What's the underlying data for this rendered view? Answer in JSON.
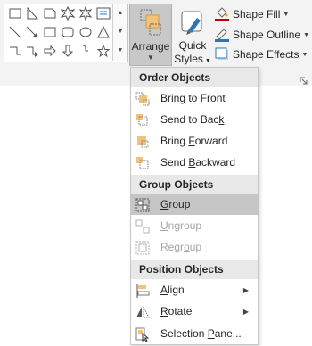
{
  "ribbon": {
    "arrange_label": "Arrange",
    "quick_styles_line1": "Quick",
    "quick_styles_line2": "Styles",
    "shape_fill": "Shape Fill",
    "shape_outline": "Shape Outline",
    "shape_effects": "Shape Effects",
    "colors": {
      "fill_bucket": "#e8a33b",
      "outline_bar": "#2e75b6",
      "fill_bar": "#c00000",
      "arrange_squares": "#f0c27b"
    }
  },
  "menu": {
    "headers": {
      "order": "Order Objects",
      "group": "Group Objects",
      "position": "Position Objects"
    },
    "items": {
      "bring_to_front": {
        "pre": "Bring to ",
        "key": "F",
        "post": "ront"
      },
      "send_to_back": {
        "pre": "Send to Bac",
        "key": "k",
        "post": ""
      },
      "bring_forward": {
        "pre": "Bring ",
        "key": "F",
        "post": "orward"
      },
      "send_backward": {
        "pre": "Send ",
        "key": "B",
        "post": "ackward"
      },
      "group": {
        "pre": "",
        "key": "G",
        "post": "roup"
      },
      "ungroup": {
        "pre": "",
        "key": "U",
        "post": "ngroup"
      },
      "regroup": {
        "pre": "Regr",
        "key": "o",
        "post": "up"
      },
      "align": {
        "pre": "",
        "key": "A",
        "post": "lign"
      },
      "rotate": {
        "pre": "",
        "key": "R",
        "post": "otate"
      },
      "selection_pane": {
        "pre": "Selection ",
        "key": "P",
        "post": "ane..."
      }
    }
  }
}
